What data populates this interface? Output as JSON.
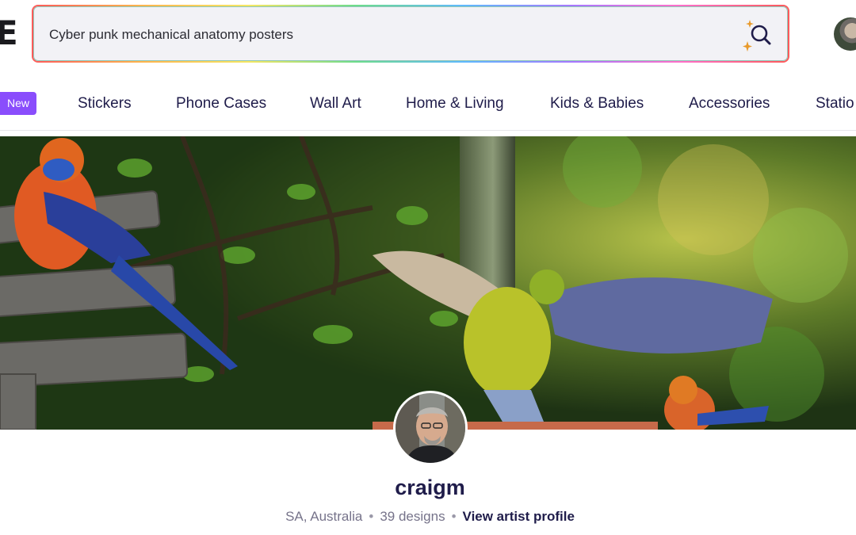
{
  "header": {
    "logo_text": "E",
    "search": {
      "value": "Cyber punk mechanical anatomy posters",
      "button_icon": "sparkle-search-icon"
    },
    "avatar_icon": "user-avatar"
  },
  "nav": {
    "badge": "New",
    "items": [
      {
        "label": "Stickers"
      },
      {
        "label": "Phone Cases"
      },
      {
        "label": "Wall Art"
      },
      {
        "label": "Home & Living"
      },
      {
        "label": "Kids & Babies"
      },
      {
        "label": "Accessories"
      },
      {
        "label": "Statio"
      }
    ]
  },
  "profile": {
    "username": "craigm",
    "location": "SA, Australia",
    "designs": "39 designs",
    "view_profile": "View artist profile"
  },
  "colors": {
    "accent": "#8a4dfc",
    "text_dark": "#1f1c4a",
    "text_muted": "#76738a"
  }
}
